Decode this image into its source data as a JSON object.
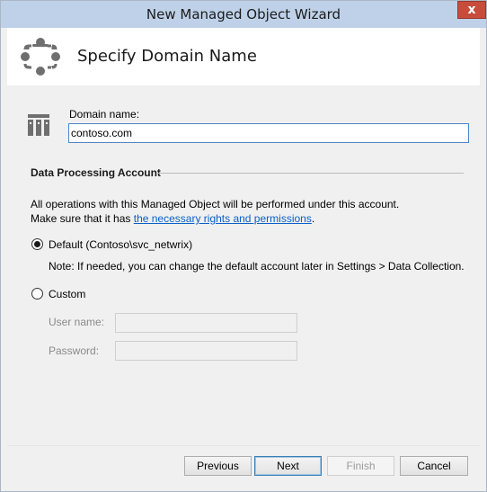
{
  "window": {
    "title": "New Managed Object Wizard",
    "close_glyph": "x"
  },
  "header": {
    "title": "Specify Domain Name",
    "icon": "managed-object-icon"
  },
  "domain": {
    "label": "Domain name:",
    "value": "contoso.com",
    "icon": "domain-building-icon"
  },
  "account": {
    "section_title": "Data Processing Account",
    "info_line1": "All operations with this Managed Object will be performed under this account.",
    "info_line2_prefix": "Make sure that it has ",
    "info_link": "the necessary rights and permissions",
    "info_line2_suffix": ".",
    "default_option": "Default (Contoso\\svc_netwrix)",
    "default_selected": true,
    "note": "Note: If needed, you can change the default account later in Settings > Data Collection.",
    "custom_option": "Custom",
    "custom_selected": false,
    "username_label": "User name:",
    "username_value": "",
    "password_label": "Password:",
    "password_value": ""
  },
  "buttons": {
    "previous": "Previous",
    "next": "Next",
    "finish": "Finish",
    "cancel": "Cancel"
  },
  "colors": {
    "titlebar": "#bed1e8",
    "close_button": "#c74c3c",
    "link": "#0b5fc8",
    "input_focus_border": "#4d86c7",
    "icon_gray": "#6f6f6f"
  }
}
